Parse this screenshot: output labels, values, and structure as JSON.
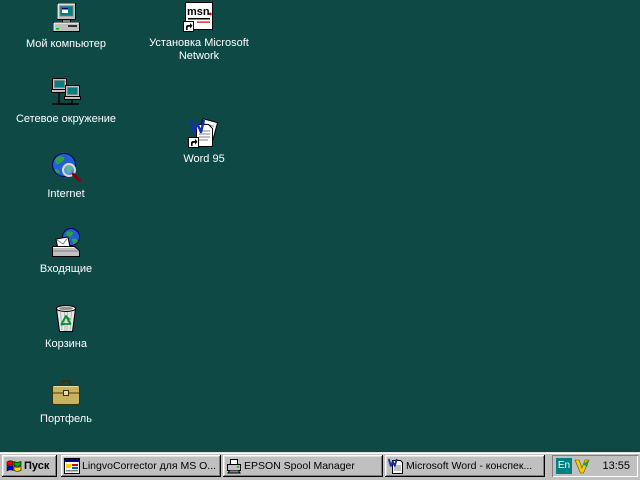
{
  "colors": {
    "desktop": "#0e4946",
    "taskbar": "#c0c0c0",
    "label_text": "#ffffff",
    "language_indicator": "#008080"
  },
  "desktop": {
    "icons": [
      {
        "label": "Мой компьютер",
        "icon": "my-computer-icon"
      },
      {
        "label": "Сетевое окружение",
        "icon": "network-neighborhood-icon"
      },
      {
        "label": "Internet",
        "icon": "internet-globe-icon"
      },
      {
        "label": "Входящие",
        "icon": "inbox-icon"
      },
      {
        "label": "Корзина",
        "icon": "recycle-bin-icon"
      },
      {
        "label": "Портфель",
        "icon": "briefcase-icon"
      },
      {
        "label": "Установка Microsoft Network",
        "icon": "msn-setup-icon",
        "logo_text": "msn"
      },
      {
        "label": "Word 95",
        "icon": "word-document-icon"
      }
    ]
  },
  "taskbar": {
    "start": {
      "label": "Пуск",
      "icon": "windows-flag-icon"
    },
    "tasks": [
      {
        "label": "LingvoCorrector для MS O...",
        "icon": "lingvo-corrector-icon"
      },
      {
        "label": "EPSON Spool Manager",
        "icon": "printer-icon"
      },
      {
        "label": "Microsoft Word - конспек...",
        "icon": "word-icon"
      }
    ],
    "tray": {
      "language": "En",
      "app_icon": "tray-app-icon",
      "clock": "13:55"
    }
  }
}
